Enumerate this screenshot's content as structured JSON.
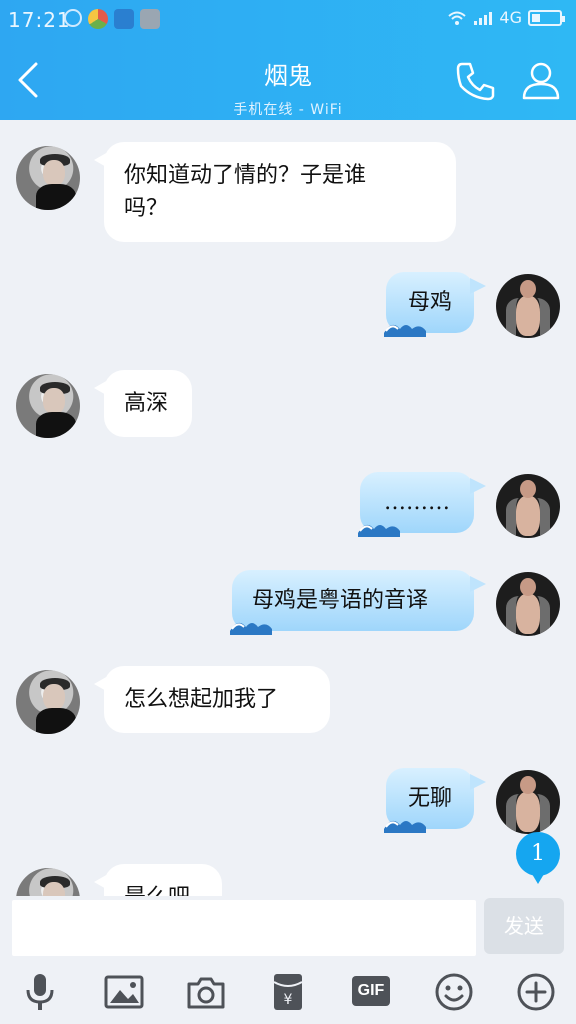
{
  "status_bar": {
    "time": "17:21",
    "network": "4G"
  },
  "header": {
    "title": "烟鬼",
    "subtitle": "手机在线 - WiFi"
  },
  "messages": [
    {
      "side": "in",
      "text_lines": [
        "你知道动了情的？子是谁",
        "吗？"
      ]
    },
    {
      "side": "out",
      "text": "母鸡"
    },
    {
      "side": "in",
      "text": "高深"
    },
    {
      "side": "out",
      "text": "………"
    },
    {
      "side": "out",
      "text": "母鸡是粤语的音译"
    },
    {
      "side": "in",
      "text": "怎么想起加我了"
    },
    {
      "side": "out",
      "text": "无聊"
    },
    {
      "side": "in",
      "text": "是么吧"
    }
  ],
  "unread_count": "1",
  "composer": {
    "placeholder": "",
    "send_label": "发送"
  },
  "toolbar": {
    "gif_label": "GIF"
  },
  "colors": {
    "header_start": "#2ea7f2",
    "header_end": "#2fb8f4",
    "accent": "#15a6f0"
  }
}
